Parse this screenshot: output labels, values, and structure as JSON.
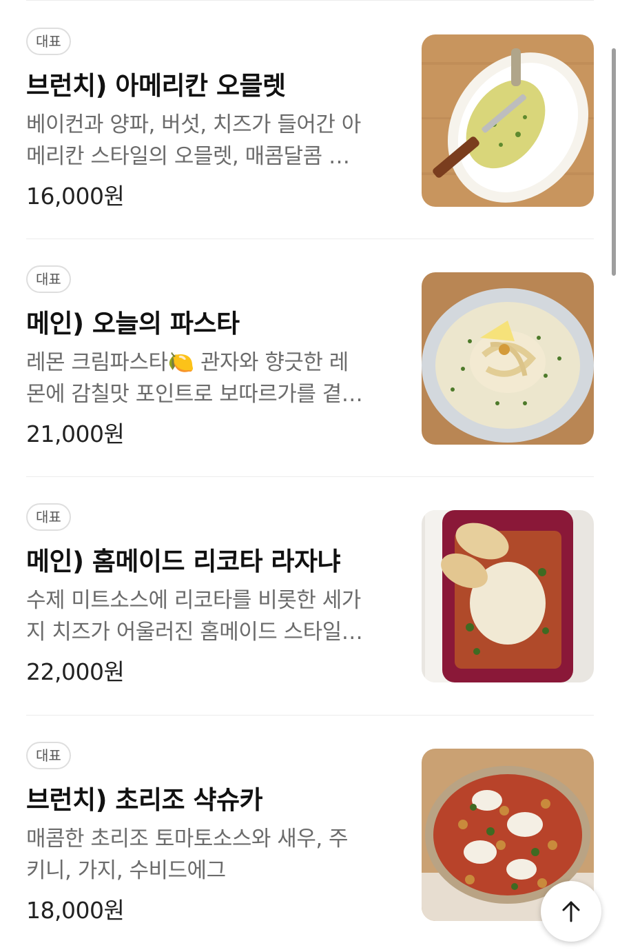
{
  "menu": {
    "items": [
      {
        "badge": "대표",
        "title": "브런치) 아메리칸 오믈렛",
        "desc_line1": "베이컨과 양파, 버섯, 치즈가 들어간 아",
        "desc_line2": "메리칸 스타일의 오믈렛, 매콤달콤 …",
        "price": "16,000원",
        "image_icon": "omelette-photo"
      },
      {
        "badge": "대표",
        "title": "메인) 오늘의 파스타",
        "desc_line1": "레몬 크림파스타🍋 관자와 향긋한 레",
        "desc_line2": "몬에 감칠맛 포인트로 보따르가를 곁…",
        "price": "21,000원",
        "image_icon": "pasta-photo"
      },
      {
        "badge": "대표",
        "title": "메인) 홈메이드 리코타 라자냐",
        "desc_line1": "수제 미트소스에 리코타를 비롯한 세가",
        "desc_line2": "지 치즈가 어울러진 홈메이드 스타일…",
        "price": "22,000원",
        "image_icon": "lasagna-photo"
      },
      {
        "badge": "대표",
        "title": "브런치) 초리조 샥슈카",
        "desc_line1": "매콤한 초리조 토마토소스와 새우, 주",
        "desc_line2": "키니, 가지, 수비드에그",
        "price": "18,000원",
        "image_icon": "shakshuka-photo"
      }
    ]
  },
  "scroll_top_icon": "arrow-up-icon",
  "colors": {
    "badge_border": "#dedede",
    "desc_text": "#6b6b6b",
    "divider": "#ececec"
  }
}
